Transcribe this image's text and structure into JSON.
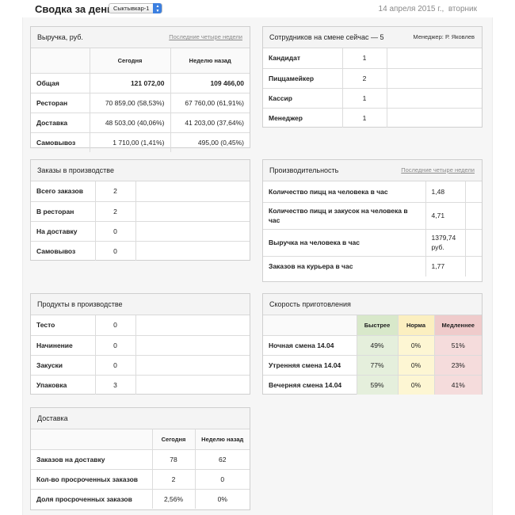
{
  "header": {
    "title": "Сводка за день",
    "city": "Сыктывкар-1",
    "date": "14 апреля 2015 г.,",
    "weekday": "вторник"
  },
  "revenue": {
    "title": "Выручка, руб.",
    "link": "Последние четыре недели",
    "columns": [
      "Сегодня",
      "Неделю назад"
    ],
    "rows": [
      {
        "label": "Общая",
        "today": "121 072,00",
        "week": "109 466,00"
      },
      {
        "label": "Ресторан",
        "today": "70 859,00 (58,53%)",
        "week": "67 760,00 (61,91%)"
      },
      {
        "label": "Доставка",
        "today": "48 503,00 (40,06%)",
        "week": "41 203,00 (37,64%)"
      },
      {
        "label": "Самовывоз",
        "today": "1 710,00 (1,41%)",
        "week": "495,00 (0,45%)"
      }
    ]
  },
  "staff": {
    "title": "Сотрудников на смене сейчас — 5",
    "manager": "Менеджер: Р. Яковлев",
    "rows": [
      {
        "label": "Кандидат",
        "value": "1"
      },
      {
        "label": "Пиццамейкер",
        "value": "2"
      },
      {
        "label": "Кассир",
        "value": "1"
      },
      {
        "label": "Менеджер",
        "value": "1"
      }
    ]
  },
  "orders": {
    "title": "Заказы в производстве",
    "rows": [
      {
        "label": "Всего заказов",
        "value": "2"
      },
      {
        "label": "В ресторан",
        "value": "2"
      },
      {
        "label": "На доставку",
        "value": "0"
      },
      {
        "label": "Самовывоз",
        "value": "0"
      }
    ]
  },
  "productivity": {
    "title": "Производительность",
    "link": "Последние четыре недели",
    "rows": [
      {
        "label": "Количество пицц на человека в час",
        "value": "1,48"
      },
      {
        "label": "Количество пицц и закусок на человека в час",
        "value": "4,71"
      },
      {
        "label": "Выручка на человека в час",
        "value": "1379,74 руб."
      },
      {
        "label": "Заказов на курьера в час",
        "value": "1,77"
      }
    ]
  },
  "products": {
    "title": "Продукты в производстве",
    "rows": [
      {
        "label": "Тесто",
        "value": "0"
      },
      {
        "label": "Начинение",
        "value": "0"
      },
      {
        "label": "Закуски",
        "value": "0"
      },
      {
        "label": "Упаковка",
        "value": "3"
      }
    ]
  },
  "speed": {
    "title": "Скорость приготовления",
    "columns": [
      "Быстрее",
      "Норма",
      "Медленнее"
    ],
    "colors": {
      "fast": "#e5efdc",
      "norm": "#fdf6d3",
      "slow": "#f5dcdc"
    },
    "rows": [
      {
        "label": "Ночная смена 14.04",
        "fast": "49%",
        "norm": "0%",
        "slow": "51%"
      },
      {
        "label": "Утренняя смена 14.04",
        "fast": "77%",
        "norm": "0%",
        "slow": "23%"
      },
      {
        "label": "Вечерняя смена 14.04",
        "fast": "59%",
        "norm": "0%",
        "slow": "41%"
      }
    ]
  },
  "delivery": {
    "title": "Доставка",
    "columns": [
      "Сегодня",
      "Неделю назад"
    ],
    "rows": [
      {
        "label": "Заказов на доставку",
        "today": "78",
        "week": "62"
      },
      {
        "label": "Кол-во просроченных заказов",
        "today": "2",
        "week": "0"
      },
      {
        "label": "Доля просроченных заказов",
        "today": "2,56%",
        "week": "0%"
      }
    ]
  }
}
